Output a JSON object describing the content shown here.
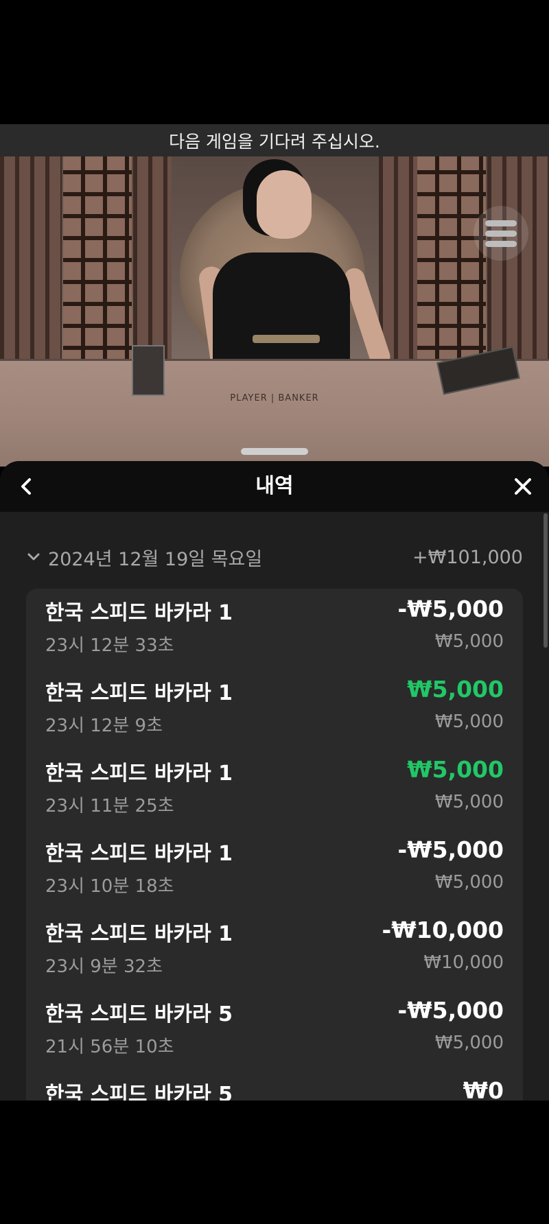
{
  "banner": {
    "text": "다음 게임을 기다려 주십시오."
  },
  "video": {
    "table_label": "PLAYER | BANKER"
  },
  "sheet": {
    "title": "내역"
  },
  "history": {
    "date": "2024년 12월 19일 목요일",
    "date_total": "+₩101,000",
    "items": [
      {
        "game": "한국 스피드 바카라 1",
        "time": "23시 12분 33초",
        "result": "-₩5,000",
        "bet": "₩5,000",
        "win": false
      },
      {
        "game": "한국 스피드 바카라 1",
        "time": "23시 12분 9초",
        "result": "₩5,000",
        "bet": "₩5,000",
        "win": true
      },
      {
        "game": "한국 스피드 바카라 1",
        "time": "23시 11분 25초",
        "result": "₩5,000",
        "bet": "₩5,000",
        "win": true
      },
      {
        "game": "한국 스피드 바카라 1",
        "time": "23시 10분 18초",
        "result": "-₩5,000",
        "bet": "₩5,000",
        "win": false
      },
      {
        "game": "한국 스피드 바카라 1",
        "time": "23시 9분 32초",
        "result": "-₩10,000",
        "bet": "₩10,000",
        "win": false
      },
      {
        "game": "한국 스피드 바카라 5",
        "time": "21시 56분 10초",
        "result": "-₩5,000",
        "bet": "₩5,000",
        "win": false
      },
      {
        "game": "한국 스피드 바카라 5",
        "time": "",
        "result": "₩0",
        "bet": "",
        "win": false
      }
    ]
  },
  "colors": {
    "win": "#22c767",
    "loss": "#ffffff",
    "sheet_bg": "#1f1f1f",
    "header_bg": "#0d0d0d"
  }
}
